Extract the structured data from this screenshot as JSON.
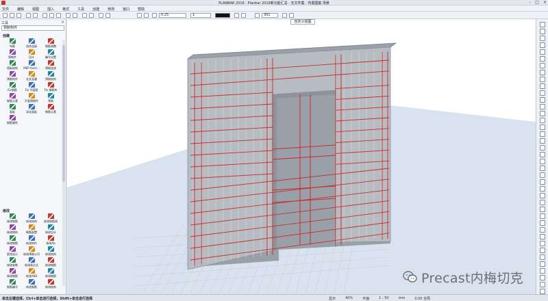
{
  "window": {
    "title": "PLANBAR 2016 · Planbar 2016新功能汇总 · 无文件集 · 布置图集 场景"
  },
  "menu": [
    "文件",
    "编辑",
    "视图",
    "插入",
    "格式",
    "工具",
    "创建",
    "修改",
    "窗口",
    "帮助"
  ],
  "toolbar": {
    "pen_value": "0.25",
    "line_value": "1",
    "layer_value": "301"
  },
  "left_panel": {
    "caption": "工具",
    "path": "预制构件",
    "section1_title": "创建",
    "section1_tools": [
      "布筋",
      "组合连接",
      "钢筋调整",
      "预制件",
      "设计",
      "编号设置",
      "墙板结构",
      "MEP Anch...",
      "预制连接",
      "预制构件",
      "交叉混凝",
      "预制结构",
      "Fix钢筋",
      "Fix 平面图",
      "Fix 钢筋库",
      "钢筋元素",
      "开窗预制件",
      "预制",
      "面板",
      "深化面板",
      "钢筋元素",
      "钢筋属性"
    ],
    "section2_title": "修改",
    "section2_tools": [
      "修改钢筋",
      "修改结构",
      "修改钢筋网",
      "修改钢构",
      "钢筋配置",
      "修改设计",
      "修改钢筋",
      "修改构件",
      "修改Ab",
      "更改显示",
      "修改预制公司",
      "修改结构",
      "修改参数",
      "修改表达式",
      "修改钢筋",
      "修改钢筋",
      "修改ANS",
      "修改钢筋",
      "钢筋编号",
      "修改钢筋",
      "修改结构"
    ]
  },
  "viewport": {
    "view_label": "自定义视图",
    "background_color": "#ffffff",
    "ground_color": "#d8e3ef",
    "wall_color": "#b7bcc3",
    "rebar_color": "#cc2a2a"
  },
  "status": {
    "left_text": "单击左键选择，Ctrl+单击进行选择，Shift+单击进行选择",
    "items": [
      "显示",
      "40%",
      "平面",
      "1 : 50",
      "mm",
      "0.00 全局"
    ]
  },
  "watermark": {
    "text": "Precast内梅切克",
    "icon": "wechat-bubble-icon"
  }
}
